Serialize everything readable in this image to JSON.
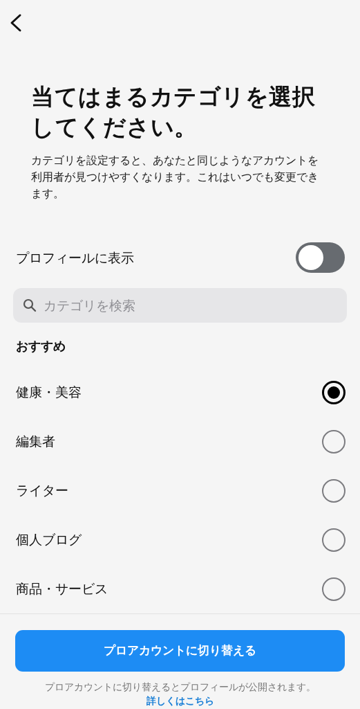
{
  "title": "当てはまるカテゴリを選択してください。",
  "description": "カテゴリを設定すると、あなたと同じようなアカウントを利用者が見つけやすくなります。これはいつでも変更できます。",
  "display_toggle": {
    "label": "プロフィールに表示",
    "on": false
  },
  "search": {
    "placeholder": "カテゴリを検索"
  },
  "section_heading": "おすすめ",
  "options": [
    {
      "label": "健康・美容",
      "selected": true
    },
    {
      "label": "編集者",
      "selected": false
    },
    {
      "label": "ライター",
      "selected": false
    },
    {
      "label": "個人ブログ",
      "selected": false
    },
    {
      "label": "商品・サービス",
      "selected": false
    }
  ],
  "primary_button": "プロアカウントに切り替える",
  "footer": {
    "text": "プロアカウントに切り替えるとプロフィールが公開されます。",
    "link": "詳しくはこちら"
  }
}
